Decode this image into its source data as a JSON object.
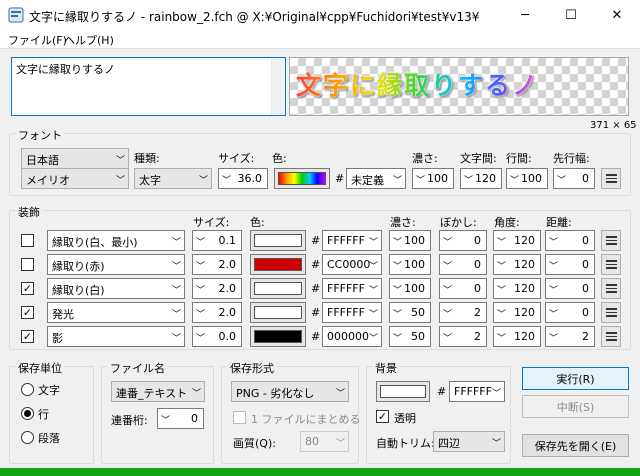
{
  "window": {
    "title": "文字に縁取りするノ - rainbow_2.fch @ X:¥Original¥cpp¥Fuchidori¥test¥v13¥"
  },
  "title_controls": {
    "minimize": "─",
    "maximize": "☐",
    "close": "✕"
  },
  "menu": [
    "ファイル(F)",
    "ヘルプ(H)"
  ],
  "text_input": {
    "value": "文字に縁取りするノ"
  },
  "preview": {
    "text": "文字に縁取りするノ",
    "size_label": "371 × 65"
  },
  "font": {
    "group_label": "フォント",
    "labels": {
      "type": "種類:",
      "size": "サイズ:",
      "color": "色:",
      "density": "濃さ:",
      "char_spacing": "文字間:",
      "line_spacing": "行間:",
      "line_width": "先行幅:"
    },
    "language": "日本語",
    "family": "メイリオ",
    "style": "太字",
    "size": "36.0",
    "hash": "#",
    "color_code": "未定義",
    "density": "100",
    "char_spacing": "120",
    "line_spacing": "100",
    "line_width": "0"
  },
  "decoration": {
    "group_label": "装飾",
    "headers": {
      "size": "サイズ:",
      "color": "色:",
      "density": "濃さ:",
      "blur": "ぼかし:",
      "angle": "角度:",
      "distance": "距離:"
    },
    "rows": [
      {
        "checked": false,
        "name": "縁取り(白、最小)",
        "size": "0.1",
        "color": "#FFFFFF",
        "code": "FFFFFF",
        "density": "100",
        "blur": "0",
        "angle": "120",
        "distance": "0"
      },
      {
        "checked": false,
        "name": "縁取り(赤)",
        "size": "2.0",
        "color": "#CC0000",
        "code": "CC0000",
        "density": "100",
        "blur": "0",
        "angle": "120",
        "distance": "0"
      },
      {
        "checked": true,
        "name": "縁取り(白)",
        "size": "2.0",
        "color": "#FFFFFF",
        "code": "FFFFFF",
        "density": "100",
        "blur": "0",
        "angle": "120",
        "distance": "0"
      },
      {
        "checked": true,
        "name": "発光",
        "size": "2.0",
        "color": "#FFFFFF",
        "code": "FFFFFF",
        "density": "50",
        "blur": "2",
        "angle": "120",
        "distance": "0"
      },
      {
        "checked": true,
        "name": "影",
        "size": "0.0",
        "color": "#000000",
        "code": "000000",
        "density": "50",
        "blur": "2",
        "angle": "120",
        "distance": "2"
      }
    ]
  },
  "save_unit": {
    "label": "保存単位",
    "options": [
      "文字",
      "行",
      "段落"
    ],
    "selected": 1
  },
  "file_name": {
    "label": "ファイル名",
    "mode": "連番_テキスト",
    "digits_label": "連番桁:",
    "digits": "0"
  },
  "save_format": {
    "label": "保存形式",
    "format": "PNG - 劣化なし",
    "merge_label": "1 ファイルにまとめる",
    "quality_label": "画質(Q):",
    "quality": "80"
  },
  "background": {
    "label": "背景",
    "hash": "#",
    "code": "FFFFFF",
    "transparent_label": "透明",
    "transparent": true,
    "trim_label": "自動トリム:",
    "trim": "四辺"
  },
  "buttons": {
    "run": "実行(R)",
    "stop": "中断(S)",
    "open_dest": "保存先を開く(E)"
  },
  "status_color": "#16a316"
}
